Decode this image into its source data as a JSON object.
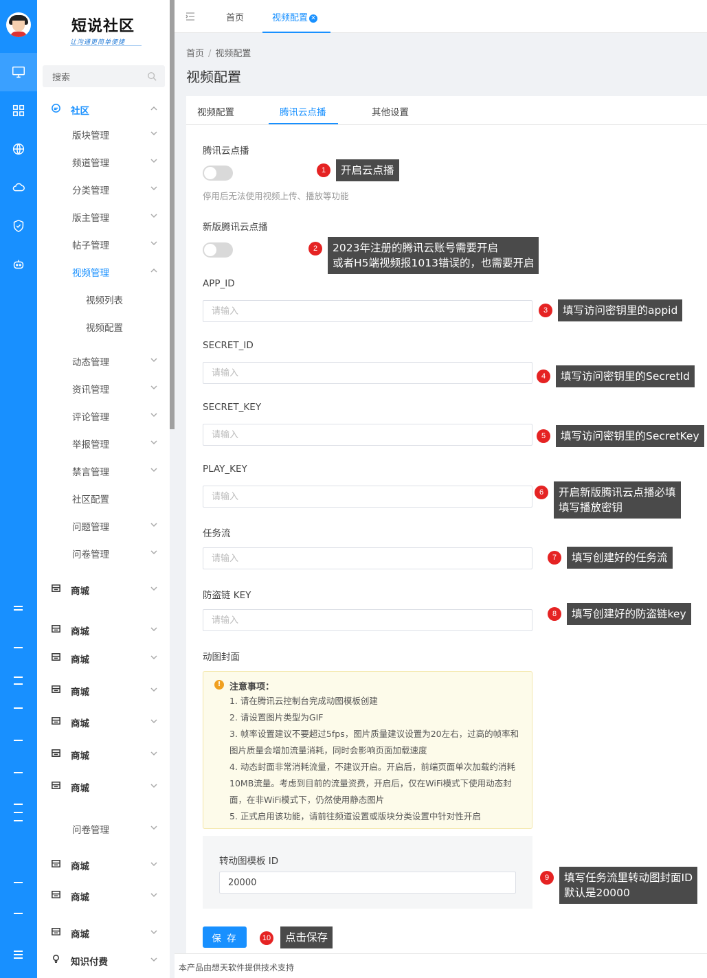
{
  "brand": {
    "title": "短说社区",
    "slogan": "让沟通更简单便捷"
  },
  "rail": {
    "icons": [
      "monitor-icon",
      "apps-grid-icon",
      "globe-icon",
      "cloud-icon",
      "shield-check-icon",
      "robot-icon",
      "menu-lines-icon"
    ]
  },
  "sidebar": {
    "search_label": "搜索",
    "community": "社区",
    "items": [
      "版块管理",
      "频道管理",
      "分类管理",
      "版主管理",
      "帖子管理",
      "视频管理"
    ],
    "video_children": [
      "视频列表",
      "视频配置"
    ],
    "items2": [
      "动态管理",
      "资讯管理",
      "评论管理",
      "举报管理",
      "禁言管理",
      "社区配置",
      "问题管理",
      "问卷管理"
    ],
    "shop": "商城",
    "questionnaire": "问卷管理",
    "knowledge": "知识付费"
  },
  "topbar": {
    "tabs": [
      "首页",
      "视频配置"
    ]
  },
  "breadcrumb": [
    "首页",
    "视频配置"
  ],
  "page_title": "视频配置",
  "card_tabs": [
    "视频配置",
    "腾讯云点播",
    "其他设置"
  ],
  "form": {
    "vod_label": "腾讯云点播",
    "vod_hint": "停用后无法使用视频上传、播放等功能",
    "new_vod_label": "新版腾讯云点播",
    "app_id_label": "APP_ID",
    "secret_id_label": "SECRET_ID",
    "secret_key_label": "SECRET_KEY",
    "play_key_label": "PLAY_KEY",
    "task_flow_label": "任务流",
    "anti_leech_label": "防盗链 KEY",
    "gif_cover_label": "动图封面",
    "placeholder": "请输入",
    "notice_title": "注意事项：",
    "notice_lines": [
      "1. 请在腾讯云控制台完成动图模板创建",
      "2. 请设置图片类型为GIF",
      "3. 帧率设置建议不要超过5fps，图片质量建议设置为20左右，过高的帧率和图片质量会增加流量消耗，同时会影响页面加载速度",
      "4. 动态封面非常消耗流量，不建议开启。开启后，前端页面单次加载约消耗10MB流量。考虑到目前的流量资费，开启后，仅在WiFi模式下使用动态封面，在非WiFi模式下，仍然使用静态图片",
      "5. 正式启用该功能，请前往频道设置或版块分类设置中针对性开启"
    ],
    "template_label": "转动图模板 ID",
    "template_value": "20000",
    "save_label": "保 存"
  },
  "callouts": [
    {
      "num": "1",
      "text": "开启云点播"
    },
    {
      "num": "2",
      "text": "2023年注册的腾讯云账号需要开启\n或者H5端视频报1013错误的，也需要开启"
    },
    {
      "num": "3",
      "text": "填写访问密钥里的appid"
    },
    {
      "num": "4",
      "text": "填写访问密钥里的SecretId"
    },
    {
      "num": "5",
      "text": "填写访问密钥里的SecretKey"
    },
    {
      "num": "6",
      "text": "开启新版腾讯云点播必填\n填写播放密钥"
    },
    {
      "num": "7",
      "text": "填写创建好的任务流"
    },
    {
      "num": "8",
      "text": "填写创建好的防盗链key"
    },
    {
      "num": "9",
      "text": "填写任务流里转动图封面ID\n默认是20000"
    },
    {
      "num": "10",
      "text": "点击保存"
    }
  ],
  "footer": "本产品由想天软件提供技术支持",
  "colors": {
    "primary": "#1890ff",
    "badge": "#e52323",
    "callout_bg": "#4a4a4a"
  }
}
